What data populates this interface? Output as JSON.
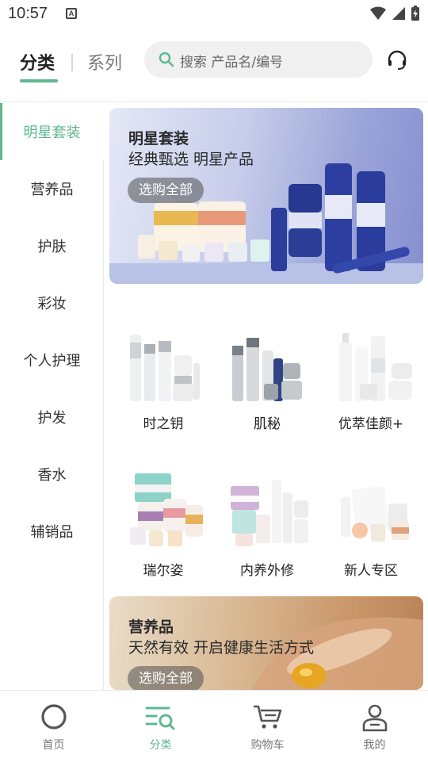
{
  "status_bar": {
    "time": "10:57",
    "notif_icon": "A"
  },
  "header": {
    "tab_category": "分类",
    "tab_series": "系列",
    "search_placeholder": "搜索 产品名/编号"
  },
  "sidebar": {
    "items": [
      {
        "label": "明星套装",
        "active": true
      },
      {
        "label": "营养品"
      },
      {
        "label": "护肤"
      },
      {
        "label": "彩妆"
      },
      {
        "label": "个人护理"
      },
      {
        "label": "护发"
      },
      {
        "label": "香水"
      },
      {
        "label": "辅销品"
      }
    ]
  },
  "banners": [
    {
      "title": "明星套装",
      "subtitle": "经典甄选 明星产品",
      "button": "选购全部"
    },
    {
      "title": "营养品",
      "subtitle": "天然有效 开启健康生活方式",
      "button": "选购全部"
    }
  ],
  "products": [
    {
      "name": "时之钥"
    },
    {
      "name": "肌秘"
    },
    {
      "name": "优萃佳颜+"
    },
    {
      "name": "瑞尔姿"
    },
    {
      "name": "内养外修"
    },
    {
      "name": "新人专区"
    }
  ],
  "tabbar": {
    "items": [
      {
        "label": "首页"
      },
      {
        "label": "分类",
        "active": true
      },
      {
        "label": "购物车"
      },
      {
        "label": "我的"
      }
    ]
  },
  "colors": {
    "accent": "#5fb88f"
  }
}
